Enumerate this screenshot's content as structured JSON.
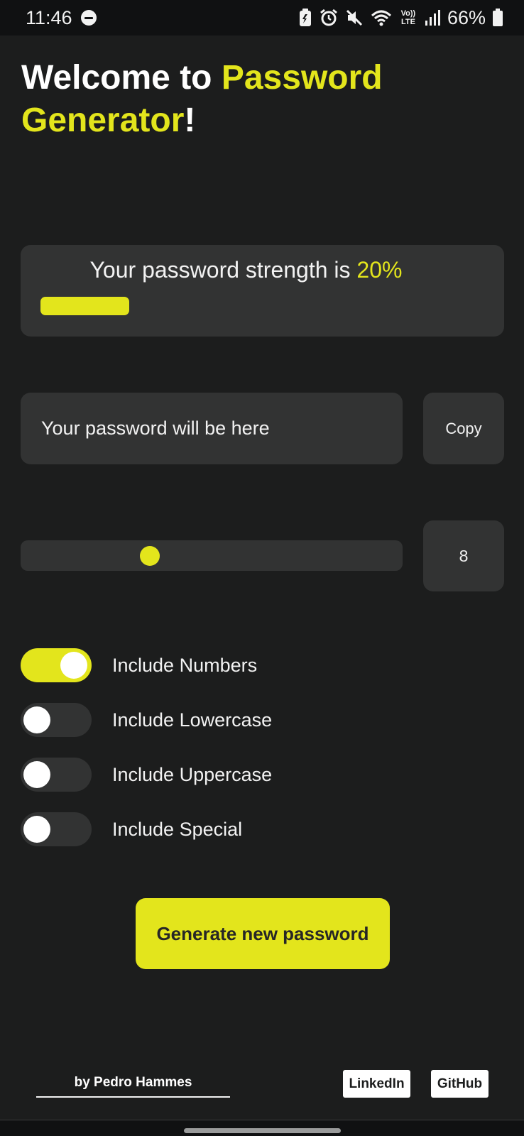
{
  "status_bar": {
    "time": "11:46",
    "network": "Vo)) LTE",
    "battery": "66%",
    "icons": [
      "dnd-icon",
      "battery-saver-icon",
      "alarm-icon",
      "mute-icon",
      "wifi-icon",
      "signal-icon",
      "battery-icon"
    ]
  },
  "header": {
    "part1": "Welcome to ",
    "accent": "Password Generator",
    "part2": "!"
  },
  "strength": {
    "prefix": "Your password strength is ",
    "value": "20%",
    "fraction": 0.2
  },
  "password": {
    "placeholder": "Your password will be here",
    "copy_label": "Copy"
  },
  "length": {
    "value": "8",
    "slider_fraction": 0.33
  },
  "options": [
    {
      "label": "Include Numbers",
      "on": true
    },
    {
      "label": "Include Lowercase",
      "on": false
    },
    {
      "label": "Include Uppercase",
      "on": false
    },
    {
      "label": "Include Special",
      "on": false
    }
  ],
  "generate_label": "Generate new password",
  "footer": {
    "author": "by Pedro Hammes",
    "linkedin": "LinkedIn",
    "github": "GitHub"
  },
  "colors": {
    "accent": "#e3e51c",
    "background": "#1c1d1d",
    "surface": "#323333"
  }
}
